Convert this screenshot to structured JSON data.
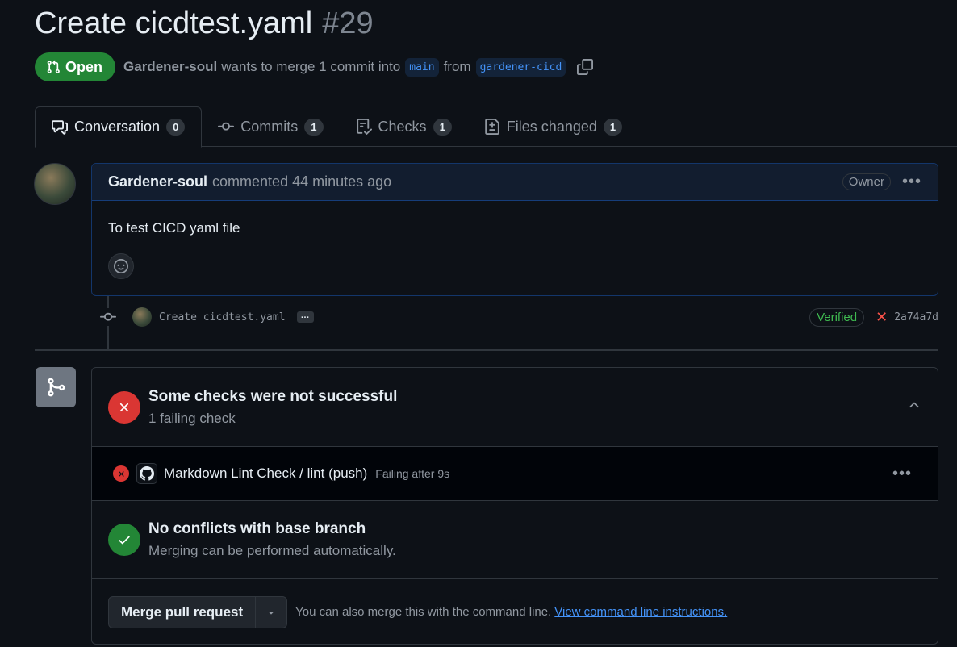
{
  "pr": {
    "title": "Create cicdtest.yaml",
    "number": "#29",
    "state": "Open",
    "author": "Gardener-soul",
    "merge_text_1": "wants to merge 1 commit into",
    "base_branch": "main",
    "merge_text_2": "from",
    "head_branch": "gardener-cicd"
  },
  "tabs": [
    {
      "label": "Conversation",
      "count": "0",
      "icon": "comment-discussion-icon"
    },
    {
      "label": "Commits",
      "count": "1",
      "icon": "git-commit-icon"
    },
    {
      "label": "Checks",
      "count": "1",
      "icon": "checklist-icon"
    },
    {
      "label": "Files changed",
      "count": "1",
      "icon": "file-diff-icon"
    }
  ],
  "comment": {
    "author": "Gardener-soul",
    "action": "commented 44 minutes ago",
    "role": "Owner",
    "body": "To test CICD yaml file"
  },
  "commit": {
    "message": "Create cicdtest.yaml",
    "ellipsis": "…",
    "verified": "Verified",
    "sha": "2a74a7d"
  },
  "merge": {
    "checks_title": "Some checks were not successful",
    "checks_sub": "1 failing check",
    "check_name": "Markdown Lint Check / lint (push)",
    "check_status": "Failing after 9s",
    "conflict_title": "No conflicts with base branch",
    "conflict_sub": "Merging can be performed automatically.",
    "merge_button": "Merge pull request",
    "cli_text": "You can also merge this with the command line.",
    "cli_link": "View command line instructions."
  },
  "colors": {
    "background": "#0d1117",
    "open_green": "#238636",
    "fail_red": "#da3633",
    "link_blue": "#4493f8"
  }
}
